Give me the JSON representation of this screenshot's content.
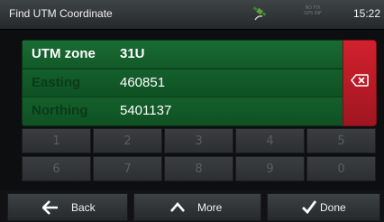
{
  "header": {
    "title": "Find UTM Coordinate",
    "gps_badge": "NO FIX\nGPS INF",
    "time": "15:22"
  },
  "coordinate": {
    "zone_label": "UTM zone",
    "zone_value": "31U",
    "easting_label": "Easting",
    "easting_value": "460851",
    "northing_label": "Northing",
    "northing_value": "5401137"
  },
  "keypad": {
    "keys": [
      "1",
      "2",
      "3",
      "4",
      "5",
      "6",
      "7",
      "8",
      "9",
      "0"
    ]
  },
  "footer": {
    "back_label": "Back",
    "more_label": "More",
    "done_label": "Done"
  },
  "colors": {
    "panel_green": "#0f4f24",
    "delete_red": "#c81e2b"
  }
}
